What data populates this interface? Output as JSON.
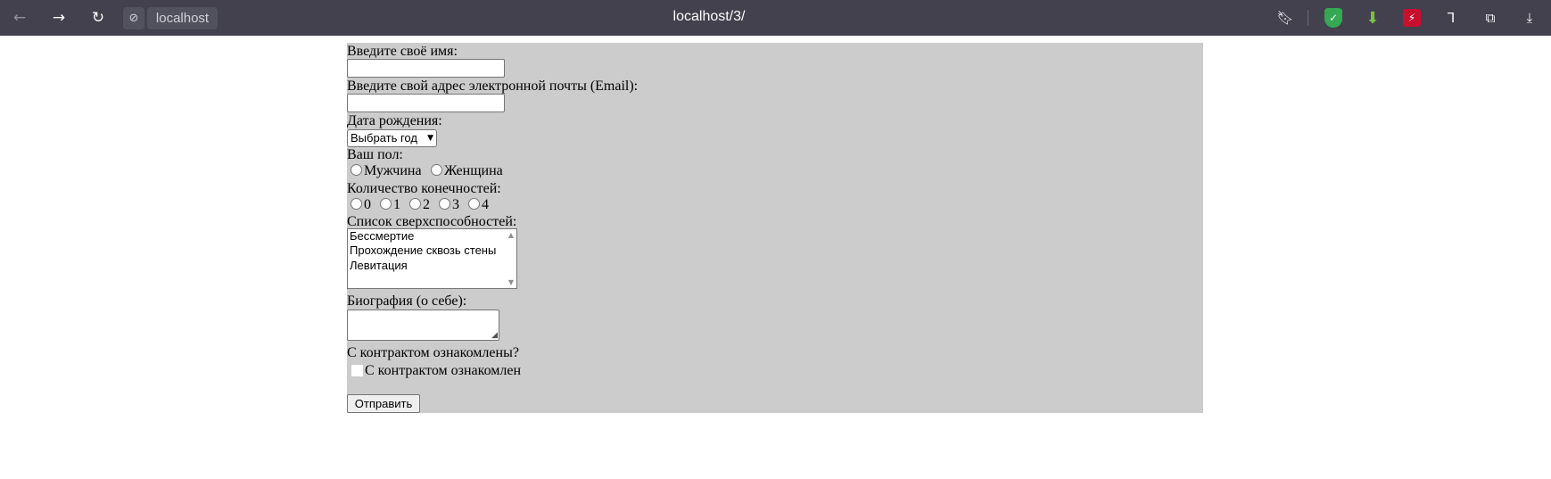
{
  "browser": {
    "site_name": "localhost",
    "url": "localhost/3/"
  },
  "form": {
    "name_label": "Введите своё имя:",
    "name_value": "",
    "email_label": "Введите свой адрес электронной почты (Email):",
    "email_value": "",
    "birth_label": "Дата рождения:",
    "birth_select": "Выбрать год",
    "gender_label": "Ваш пол:",
    "gender_options": [
      "Мужчина",
      "Женщина"
    ],
    "limbs_label": "Количество конечностей:",
    "limbs_options": [
      "0",
      "1",
      "2",
      "3",
      "4"
    ],
    "powers_label": "Список сверхспособностей:",
    "powers_options": [
      "Бессмертие",
      "Прохождение сквозь стены",
      "Левитация"
    ],
    "bio_label": "Биография (о себе):",
    "contract_question": "С контрактом ознакомлены?",
    "contract_checkbox_label": "С контрактом ознакомлен",
    "submit_label": "Отправить"
  },
  "colors": {
    "toolbar_bg": "#42414d",
    "form_bg": "#cccccc",
    "extension_green": "#34a853",
    "extension_red": "#c8102e"
  }
}
